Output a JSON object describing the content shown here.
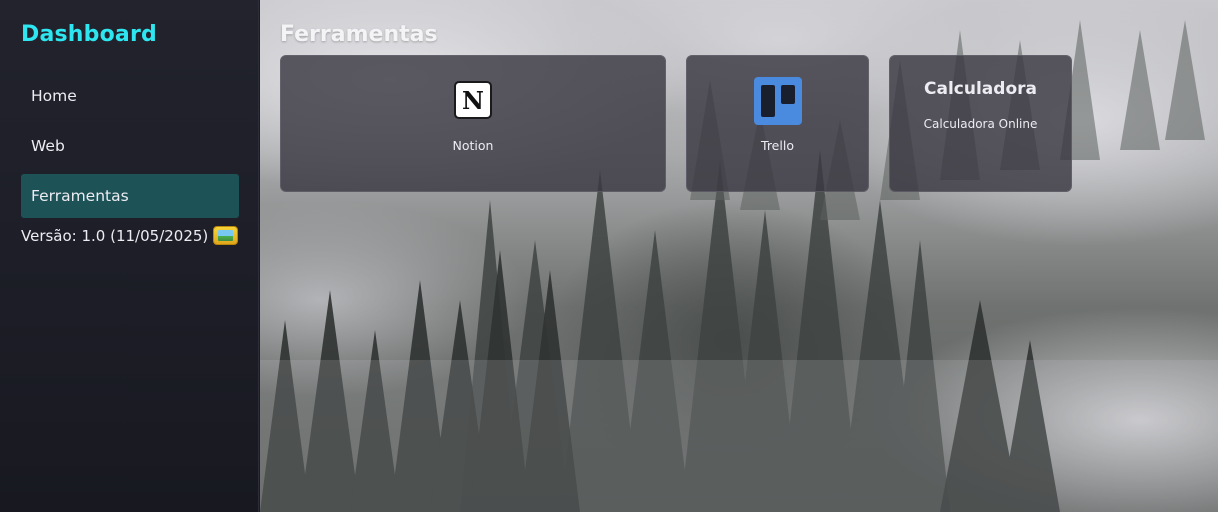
{
  "sidebar": {
    "brand": "Dashboard",
    "items": [
      {
        "label": "Home"
      },
      {
        "label": "Web"
      },
      {
        "label": "Ferramentas",
        "active": true
      }
    ],
    "version": "Versão: 1.0 (11/05/2025)",
    "version_icon": "image-icon"
  },
  "main": {
    "title": "Ferramentas",
    "cards": [
      {
        "label": "Notion",
        "icon": "notion-logo-icon"
      },
      {
        "label": "Trello",
        "icon": "trello-logo-icon"
      },
      {
        "title": "Calculadora",
        "label": "Calculadora Online"
      }
    ]
  },
  "colors": {
    "brand": "#2ee6f0",
    "active_item": "#1d5257",
    "sidebar_bg": "#1f2029",
    "card_bg": "#3a3842",
    "trello_blue": "#4a8be0"
  }
}
